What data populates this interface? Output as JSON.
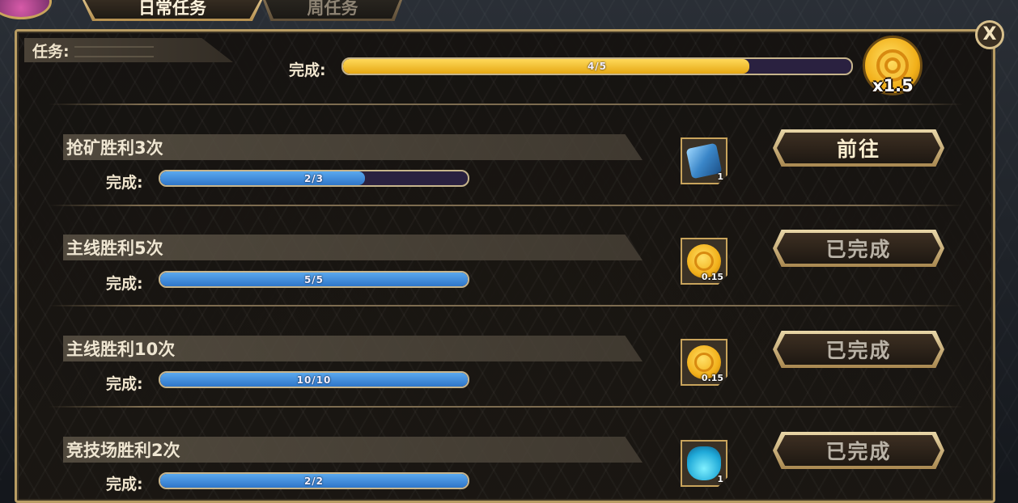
{
  "tabs": [
    {
      "label": "日常任务",
      "active": true
    },
    {
      "label": "周任务",
      "active": false
    }
  ],
  "header": {
    "task_label": "任务:",
    "done_label": "完成:",
    "progress_text": "4/5",
    "progress_fraction": 0.8,
    "multiplier": "x1.5",
    "reward_icon": "gold-coin-icon"
  },
  "close_icon": "close-icon",
  "close_label": "X",
  "colors": {
    "panel_border": "#b89c63",
    "progress_gold": "#f0b92a",
    "progress_blue": "#3f8ede",
    "bar_track": "#2a2140"
  },
  "tasks": [
    {
      "title": "抢矿胜利3次",
      "done_label": "完成:",
      "progress_text": "2/3",
      "progress_fraction": 0.667,
      "reward_icon": "crystal-icon",
      "reward_qty": "1",
      "button_label": "前往",
      "button_state": "go"
    },
    {
      "title": "主线胜利5次",
      "done_label": "完成:",
      "progress_text": "5/5",
      "progress_fraction": 1.0,
      "reward_icon": "gold-coin-icon",
      "reward_qty": "0.15",
      "button_label": "已完成",
      "button_state": "done"
    },
    {
      "title": "主线胜利10次",
      "done_label": "完成:",
      "progress_text": "10/10",
      "progress_fraction": 1.0,
      "reward_icon": "gold-coin-icon",
      "reward_qty": "0.15",
      "button_label": "已完成",
      "button_state": "done"
    },
    {
      "title": "竞技场胜利2次",
      "done_label": "完成:",
      "progress_text": "2/2",
      "progress_fraction": 1.0,
      "reward_icon": "exp-potion-icon",
      "reward_qty": "1",
      "button_label": "已完成",
      "button_state": "done"
    }
  ]
}
